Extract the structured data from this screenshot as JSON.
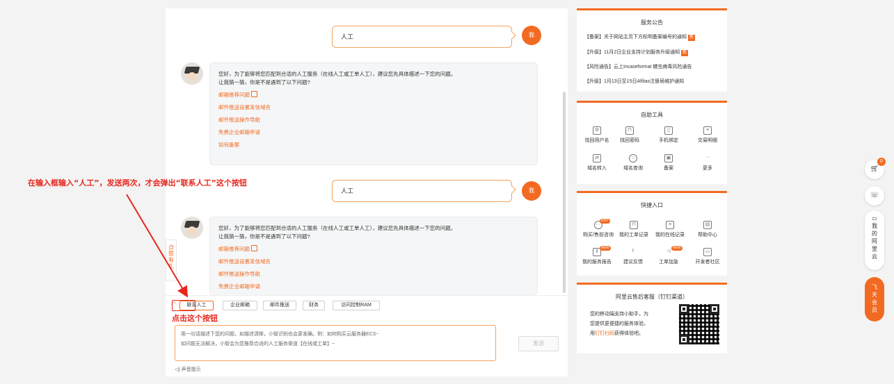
{
  "chat": {
    "user_msg_1": "人工",
    "user_msg_2": "人工",
    "me_label": "我",
    "bot_intro_line1": "您好，为了能够将您匹配到合适的人工服务（在线人工或工单人工），建议您先具体描述一下您的问题。",
    "bot_intro_line2": "让我猜一猜，你是不是遇到了以下问题?",
    "bot_links": [
      "邮箱推荐问题",
      "邮件推送设置发信域名",
      "邮件推送操作导航",
      "免费企业邮箱申请",
      "如何备案"
    ],
    "side_tab": "点赞有礼"
  },
  "quick_bar": {
    "buttons": [
      "联系人工",
      "企业邮箱",
      "邮件推送",
      "财务",
      "访问控制RAM"
    ]
  },
  "input": {
    "placeholder_line1": "用一句话描述下您的问题，如描述清晰，小智识别也会更准确。例：如何购买云服务器ECS~",
    "placeholder_line2": "如问题无法解决，小智会为您推荐合适的人工服务渠道【在线或工单】~",
    "send_label": "发送",
    "voice_label": "声音提示"
  },
  "announcement": {
    "title": "服务公告",
    "items": [
      "【备案】关于网站主页下方标明备案编号的通知",
      "【升级】11月2日企业支持计划服务升级通知",
      "【风险通告】云上Incaseformat 蠕虫病毒风险通告",
      "【升级】1月13日至15日Afilias注册局维护通知"
    ],
    "new_tag": "新"
  },
  "self_service": {
    "title": "自助工具",
    "tools": [
      "找回用户名",
      "找回密码",
      "手机绑定",
      "交易明细",
      "域名转入",
      "域名查询",
      "备案",
      "更多"
    ]
  },
  "quick_entry": {
    "title": "快捷入口",
    "items": [
      "购买/售前咨询",
      "我的工单记录",
      "我的在线记录",
      "帮助中心",
      "我的服务报告",
      "建议反馈",
      "工单加急",
      "开发者社区"
    ],
    "hot": "HOT",
    "new": "NEW"
  },
  "after_sales": {
    "title": "阿里云售后客服（钉钉渠道）",
    "line1": "您的移动端支持小助手，为",
    "line2": "您提供更便捷的服务体验。",
    "line3_prefix": "用",
    "line3_link": "钉钉扫码",
    "line3_suffix": "获得体验吧。"
  },
  "floating": {
    "cart_count": "0",
    "my_aliyun": "我的阿里云",
    "flying": "飞天会员"
  },
  "annotations": {
    "note_1": "在输入框输入“人工”，发送两次，才会弹出“联系人工”这个按钮",
    "note_2": "点击这个按钮"
  },
  "colors": {
    "accent": "#f26a21",
    "annotation": "#e8271c"
  }
}
